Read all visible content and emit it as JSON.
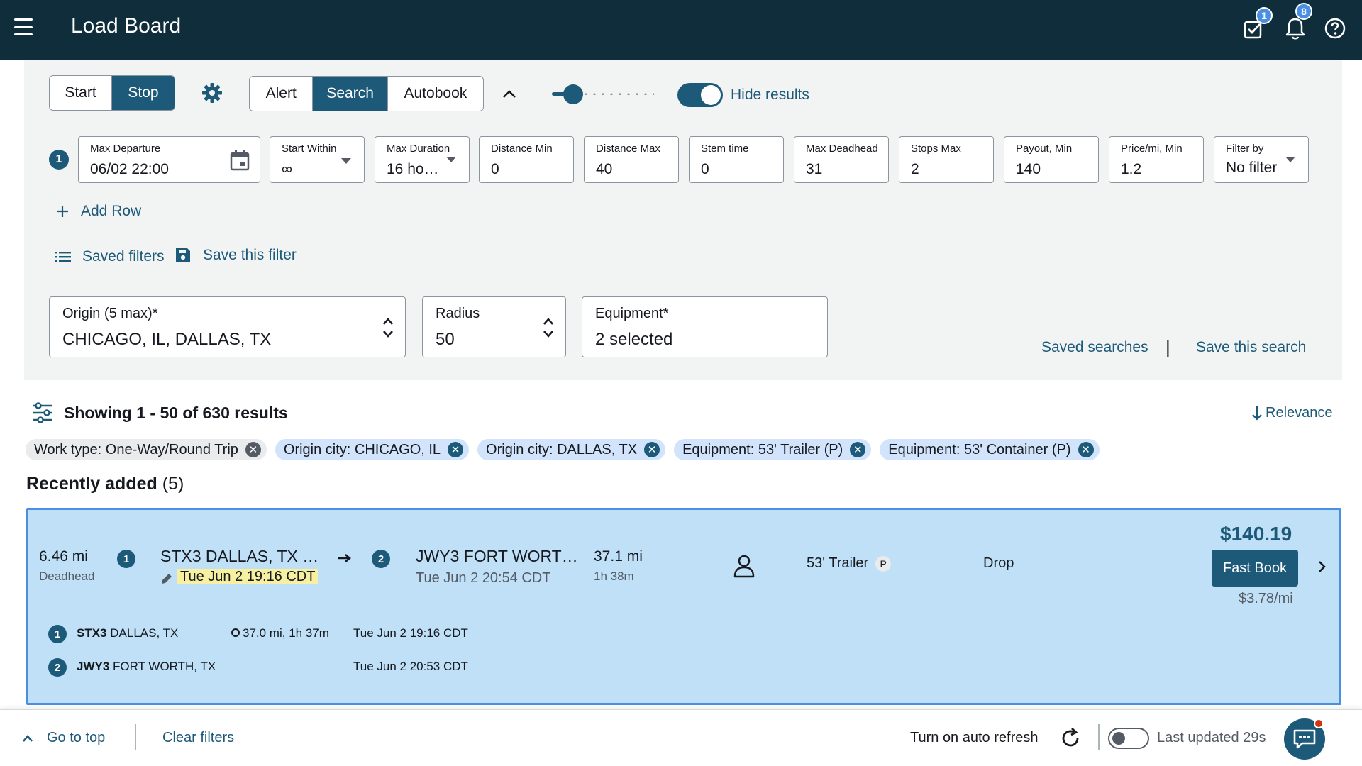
{
  "header": {
    "title": "Load Board",
    "tasks_badge": "1",
    "notifications_badge": "8"
  },
  "controls": {
    "run_options": [
      "Start",
      "Stop"
    ],
    "run_active": "Stop",
    "mode_options": [
      "Alert",
      "Search",
      "Autobook"
    ],
    "mode_active": "Search",
    "hide_results_label": "Hide results",
    "hide_results_on": true
  },
  "filter_row": {
    "row_number": "1",
    "fields": [
      {
        "label": "Max Departure",
        "value": "06/02 22:00",
        "kind": "date"
      },
      {
        "label": "Start Within",
        "value": "∞",
        "kind": "select"
      },
      {
        "label": "Max Duration",
        "value": "16 ho…",
        "kind": "select"
      },
      {
        "label": "Distance Min",
        "value": "0",
        "kind": "input"
      },
      {
        "label": "Distance Max",
        "value": "40",
        "kind": "input"
      },
      {
        "label": "Stem time",
        "value": "0",
        "kind": "input"
      },
      {
        "label": "Max Deadhead",
        "value": "31",
        "kind": "input"
      },
      {
        "label": "Stops Max",
        "value": "2",
        "kind": "input"
      },
      {
        "label": "Payout, Min",
        "value": "140",
        "kind": "input"
      },
      {
        "label": "Price/mi, Min",
        "value": "1.2",
        "kind": "input"
      },
      {
        "label": "Filter by",
        "value": "No filter",
        "kind": "select"
      }
    ],
    "add_row_label": "Add Row",
    "saved_filters_label": "Saved filters",
    "save_filter_label": "Save this filter"
  },
  "search": {
    "origin_label": "Origin (5 max)*",
    "origin_value": "CHICAGO, IL, DALLAS, TX",
    "radius_label": "Radius",
    "radius_value": "50",
    "equipment_label": "Equipment*",
    "equipment_value": "2 selected",
    "saved_searches_label": "Saved searches",
    "separator": "|",
    "save_search_label": "Save this search"
  },
  "results": {
    "summary": "Showing 1 - 50 of 630 results",
    "sort_label": "Relevance",
    "chips": [
      {
        "label": "Work type: One-Way/Round Trip",
        "style": "grey"
      },
      {
        "label": "Origin city: CHICAGO, IL",
        "style": "blue"
      },
      {
        "label": "Origin city: DALLAS, TX",
        "style": "blue"
      },
      {
        "label": "Equipment: 53' Trailer (P)",
        "style": "blue"
      },
      {
        "label": "Equipment: 53' Container (P)",
        "style": "blue"
      }
    ],
    "recent_title": "Recently added",
    "recent_count": "(5)"
  },
  "load": {
    "deadhead_value": "6.46 mi",
    "deadhead_label": "Deadhead",
    "stop1_num": "1",
    "stop1_name": "STX3 DALLAS, TX …",
    "stop1_time": "Tue Jun 2 19:16 CDT",
    "stop2_num": "2",
    "stop2_name": "JWY3 FORT WORT…",
    "stop2_time": "Tue Jun 2 20:54 CDT",
    "distance": "37.1 mi",
    "duration": "1h 38m",
    "equipment": "53' Trailer",
    "equipment_badge": "P",
    "trailer_type": "Drop",
    "price": "$140.19",
    "fast_book_label": "Fast Book",
    "rate": "$3.78/mi",
    "details": [
      {
        "num": "1",
        "code": "STX3",
        "city": "DALLAS, TX",
        "leg": "37.0 mi, 1h 37m",
        "time": "Tue Jun 2 19:16 CDT"
      },
      {
        "num": "2",
        "code": "JWY3",
        "city": "FORT WORTH, TX",
        "leg": "",
        "time": "Tue Jun 2 20:53 CDT"
      }
    ]
  },
  "footer": {
    "go_top_label": "Go to top",
    "clear_filters_label": "Clear filters",
    "auto_refresh_label": "Turn on auto refresh",
    "last_updated": "Last updated 29s"
  },
  "colors": {
    "header_bg": "#0f2d3a",
    "accent": "#1d5a79",
    "card_bg": "#bfe0f7",
    "card_border": "#4a90e2",
    "highlight": "#f6f0a0"
  }
}
